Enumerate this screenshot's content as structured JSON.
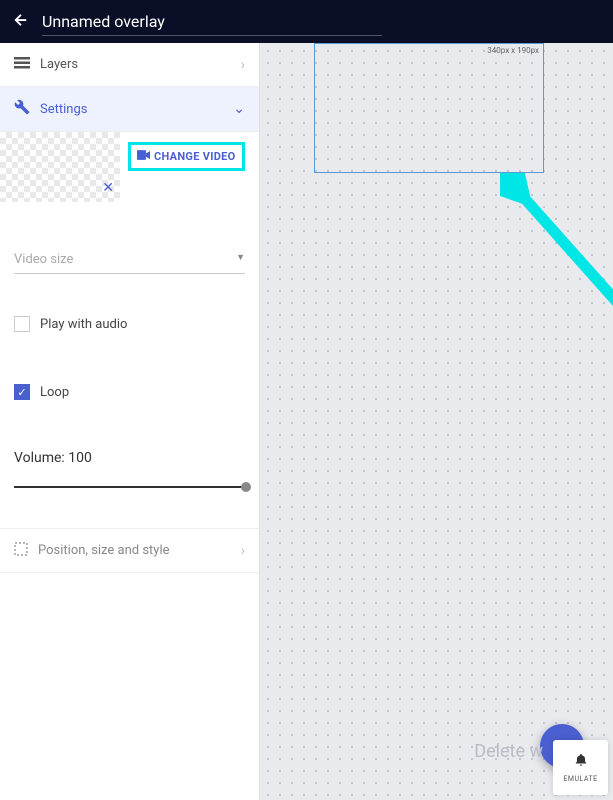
{
  "header": {
    "title": "Unnamed overlay"
  },
  "sidebar": {
    "layers": {
      "label": "Layers"
    },
    "settings": {
      "label": "Settings"
    },
    "change_video": "CHANGE VIDEO",
    "video_size_label": "Video size",
    "play_audio_label": "Play with audio",
    "play_audio_checked": false,
    "loop_label": "Loop",
    "loop_checked": true,
    "volume_label": "Volume: 100",
    "volume_value": 100,
    "position_style": {
      "label": "Position, size and style"
    }
  },
  "canvas": {
    "overlay_dimensions": "340px x 190px",
    "delete_label": "Delete w"
  },
  "emulate": {
    "label": "EMULATE"
  }
}
